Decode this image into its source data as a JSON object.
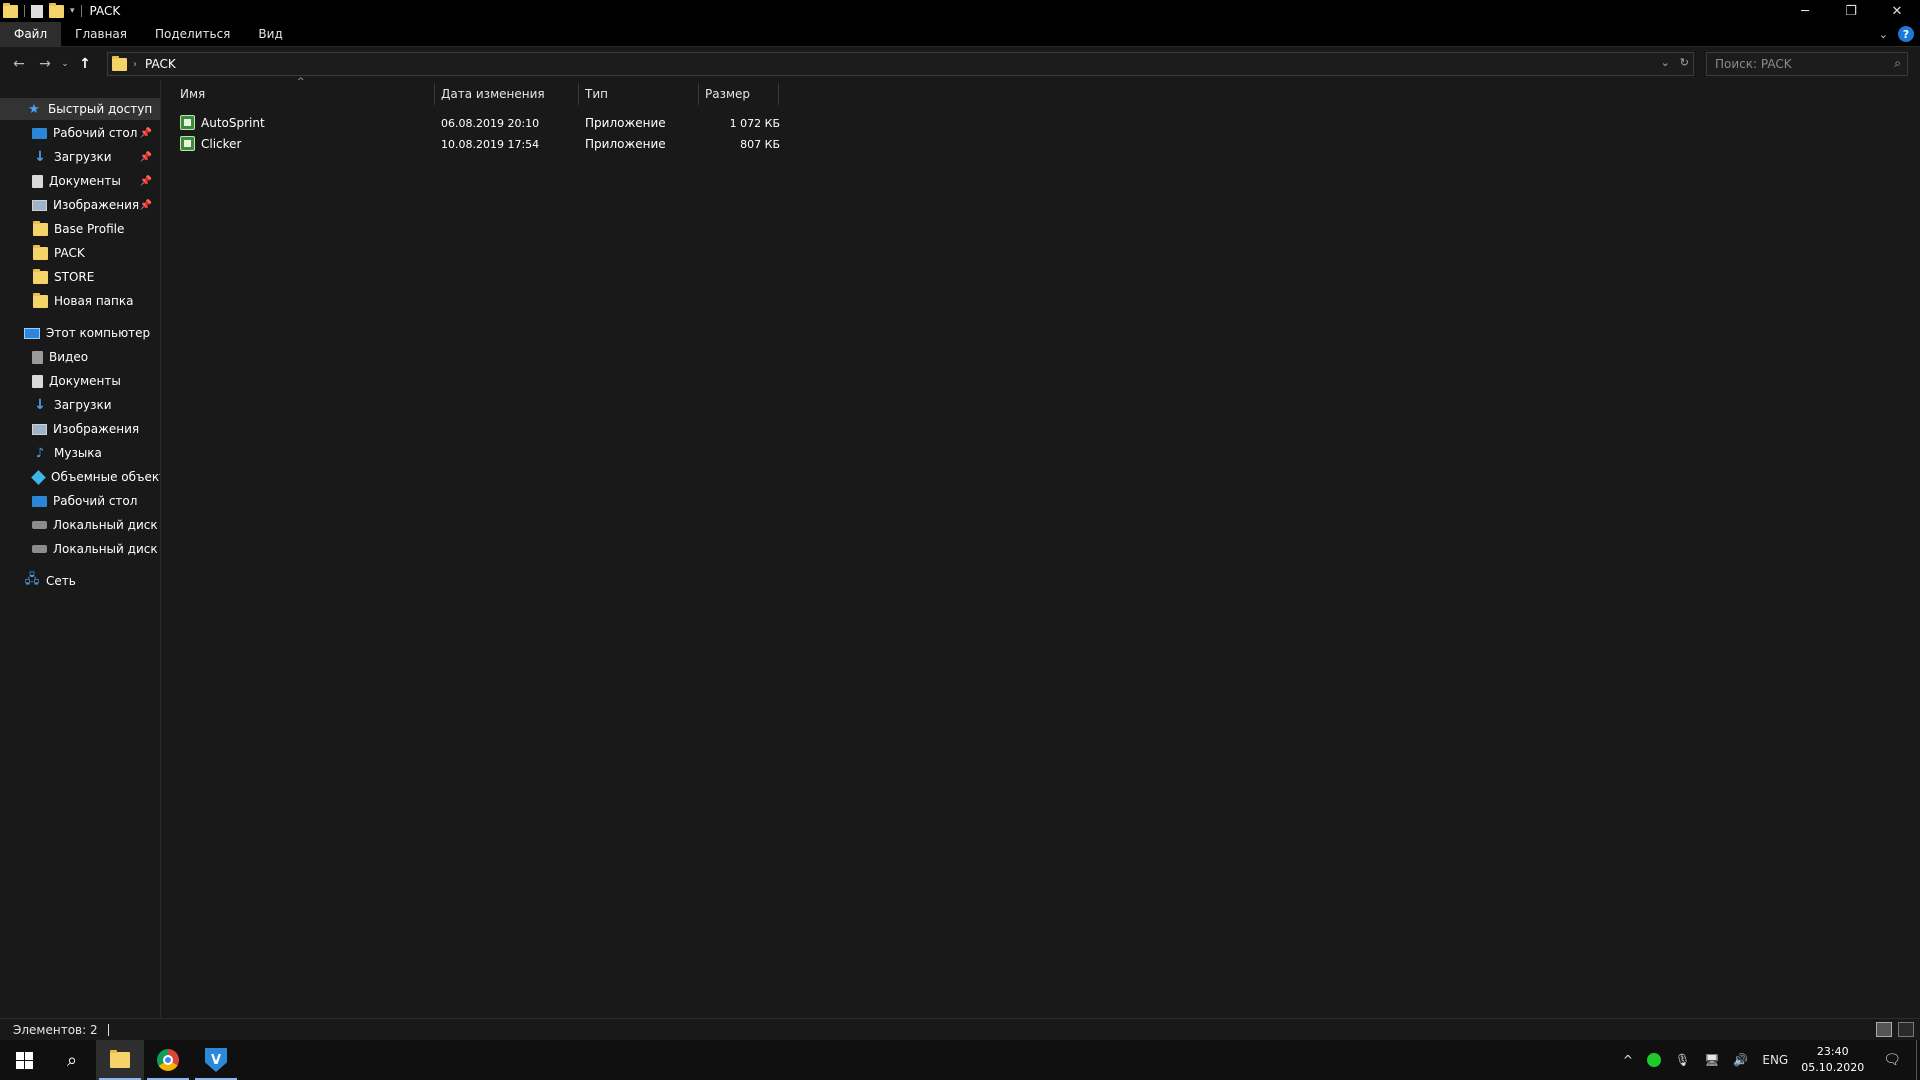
{
  "window": {
    "title": "PACK",
    "controls": {
      "minimize": "─",
      "maximize": "❐",
      "close": "✕"
    }
  },
  "ribbon": {
    "tabs": [
      "Файл",
      "Главная",
      "Поделиться",
      "Вид"
    ],
    "help": "?"
  },
  "address": {
    "crumb": "PACK",
    "search_placeholder": "Поиск: PACK"
  },
  "sidebar": {
    "quick_access": "Быстрый доступ",
    "quick_items": [
      {
        "label": "Рабочий стол",
        "icon": "desktop-icon",
        "pinned": true
      },
      {
        "label": "Загрузки",
        "icon": "downloads-icon",
        "pinned": true
      },
      {
        "label": "Документы",
        "icon": "documents-icon",
        "pinned": true
      },
      {
        "label": "Изображения",
        "icon": "pictures-icon",
        "pinned": true
      },
      {
        "label": "Base Profile",
        "icon": "folder-icon",
        "pinned": false
      },
      {
        "label": "PACK",
        "icon": "folder-icon",
        "pinned": false
      },
      {
        "label": "STORE",
        "icon": "folder-icon",
        "pinned": false
      },
      {
        "label": "Новая папка",
        "icon": "folder-icon",
        "pinned": false
      }
    ],
    "this_pc": "Этот компьютер",
    "pc_items": [
      {
        "label": "Видео",
        "icon": "video-icon"
      },
      {
        "label": "Документы",
        "icon": "documents-icon"
      },
      {
        "label": "Загрузки",
        "icon": "downloads-icon"
      },
      {
        "label": "Изображения",
        "icon": "pictures-icon"
      },
      {
        "label": "Музыка",
        "icon": "music-icon"
      },
      {
        "label": "Объемные объекты",
        "icon": "3d-objects-icon"
      },
      {
        "label": "Рабочий стол",
        "icon": "desktop-icon"
      },
      {
        "label": "Локальный диск (C:)",
        "icon": "drive-icon"
      },
      {
        "label": "Локальный диск (D:)",
        "icon": "drive-icon"
      }
    ],
    "network": "Сеть"
  },
  "columns": {
    "name": "Имя",
    "modified": "Дата изменения",
    "type": "Тип",
    "size": "Размер"
  },
  "files": [
    {
      "name": "AutoSprint",
      "modified": "06.08.2019 20:10",
      "type": "Приложение",
      "size": "1 072 КБ"
    },
    {
      "name": "Clicker",
      "modified": "10.08.2019 17:54",
      "type": "Приложение",
      "size": "807 КБ"
    }
  ],
  "status": {
    "items_count": "Элементов: 2"
  },
  "taskbar": {
    "lang": "ENG",
    "time": "23:40",
    "date": "05.10.2020"
  }
}
